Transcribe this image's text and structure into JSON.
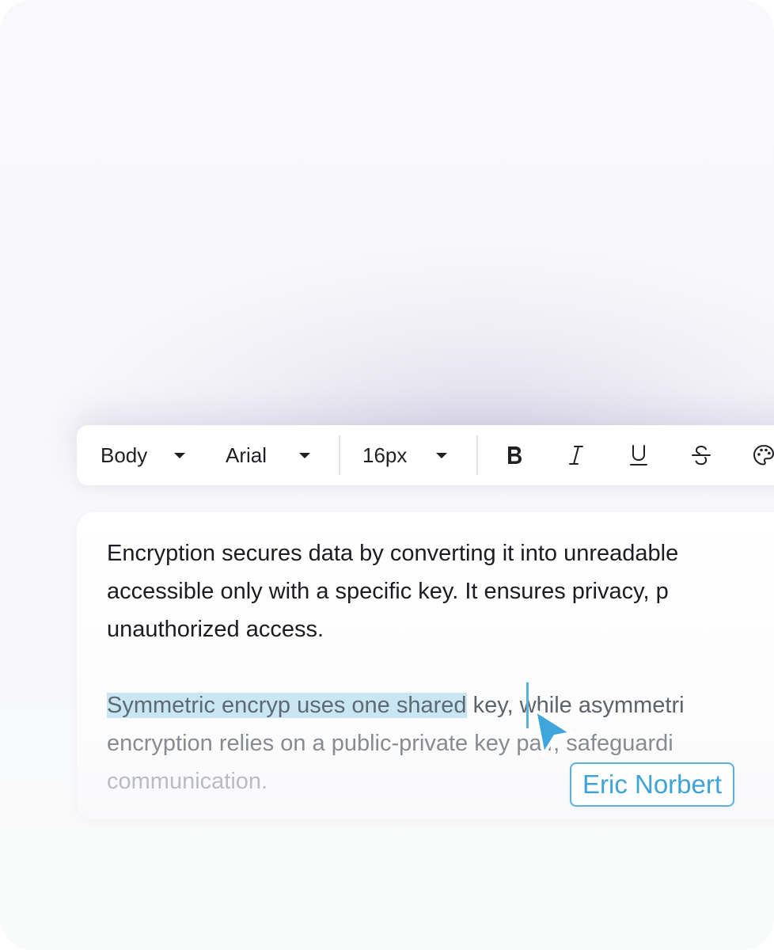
{
  "toolbar": {
    "style_dropdown": {
      "value": "Body"
    },
    "font_dropdown": {
      "value": "Arial"
    },
    "size_dropdown": {
      "value": "16px"
    },
    "format_buttons": [
      "bold-icon",
      "italic-icon",
      "underline-icon",
      "strikethrough-icon",
      "palette-icon"
    ]
  },
  "editor": {
    "paragraph1": {
      "line1": "Encryption secures data by converting it into unreadable",
      "line2": "accessible only with a specific key. It ensures privacy, p",
      "line3": "unauthorized access."
    },
    "paragraph2": {
      "line1_selected": "Symmetric encryp uses one shared",
      "line1_rest": " key, while asymmetri",
      "line2": "encryption relies on a public-private key pair, safeguardi",
      "line3": "communication."
    },
    "selection_color": "#c9e6f2"
  },
  "collaborator": {
    "name": "Eric Norbert",
    "color": "#3ea4d8"
  }
}
